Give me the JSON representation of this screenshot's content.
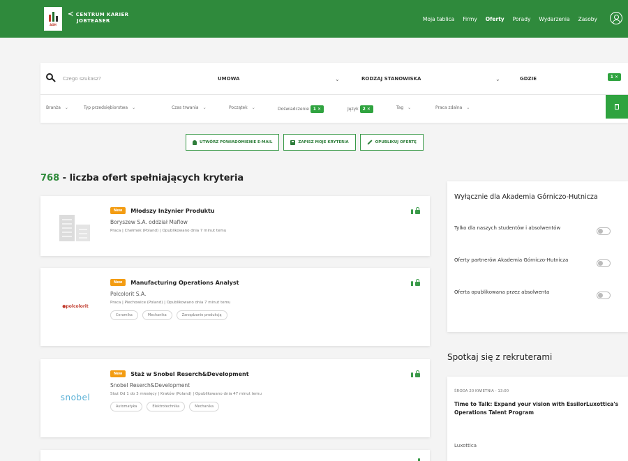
{
  "header": {
    "brand_line1": "CENTRUM KARIER",
    "brand_line2": "JOBTEASER",
    "logo_text": "AGH",
    "nav": [
      "Moja tablica",
      "Firmy",
      "Oferty",
      "Porady",
      "Wydarzenia",
      "Zasoby"
    ],
    "active_nav": "Oferty"
  },
  "search": {
    "placeholder": "Czego szukasz?",
    "contract_label": "UMOWA",
    "position_type_label": "RODZAJ STANOWISKA",
    "location_label": "GDZIE",
    "location_badge": "1 ✕"
  },
  "filters": {
    "items": [
      {
        "label": "Branża",
        "chevron": "⌄"
      },
      {
        "label": "Typ przedsiębiorstwa",
        "chevron": "⌄"
      },
      {
        "label": "Czas trwania",
        "chevron": "⌄"
      },
      {
        "label": "Początek",
        "chevron": "⌄"
      },
      {
        "label": "Doświadczenie",
        "badge": "1 ✕"
      },
      {
        "label": "Język",
        "badge": "2 ✕"
      },
      {
        "label": "Tag",
        "chevron": "⌄"
      },
      {
        "label": "Praca zdalna",
        "chevron": "⌄"
      }
    ]
  },
  "actions": {
    "email_alert": "UTWÓRZ POWIADOMIENIE E-MAIL",
    "save_criteria": "ZAPISZ MOJE KRYTERIA",
    "publish_offer": "OPUBLIKUJ OFERTĘ"
  },
  "results": {
    "count": "768",
    "count_text": " - liczba ofert spełniających kryteria"
  },
  "jobs": [
    {
      "badge": "New",
      "title": "Młodszy Inżynier Produktu",
      "company": "Boryszew S.A. oddział Maflow",
      "meta": "Praca  |  Chełmek (Poland)  |  Opublikowano dnia 7 minut temu",
      "tags": []
    },
    {
      "badge": "New",
      "title": "Manufacturing Operations Analyst",
      "company": "Polcolorit S.A.",
      "meta": "Praca  |  Piechowice (Poland)  |  Opublikowano dnia 7 minut temu",
      "tags": [
        "Ceramika",
        "Mechanika",
        "Zarządzanie produkcją"
      ],
      "logo_text": "●polcolorit"
    },
    {
      "badge": "New",
      "title": "Staż w Snobel Reserch&Development",
      "company": "Snobel Reserch&Development",
      "meta": "Staż Od 1 do 3 miesięcy  |  Kraków (Poland)  |  Opublikowano dnia 47 minut temu",
      "tags": [
        "Automatyka",
        "Elektrotechnika",
        "Mechanika"
      ],
      "logo_text": "snobel"
    }
  ],
  "sidebar": {
    "title": "Wyłącznie dla Akademia Górniczo-Hutnicza",
    "toggles": [
      "Tylko dla naszych studentów i absolwentów",
      "Oferty partnerów Akademia Górniczo-Hutnicza",
      "Oferta opublikowana przez absolwenta"
    ]
  },
  "events": {
    "section_title": "Spotkaj się z rekruterami",
    "items": [
      {
        "date": "ŚRODA 20 KWIETNIA - 13:00",
        "title": "Time to Talk: Expand your vision with EssilorLuxottica's Operations Talent Program",
        "org": "Luxottica"
      }
    ]
  },
  "colors": {
    "primary": "#2f8a3c",
    "badge_new": "#f39c12",
    "accent_green": "#2fa33f"
  }
}
